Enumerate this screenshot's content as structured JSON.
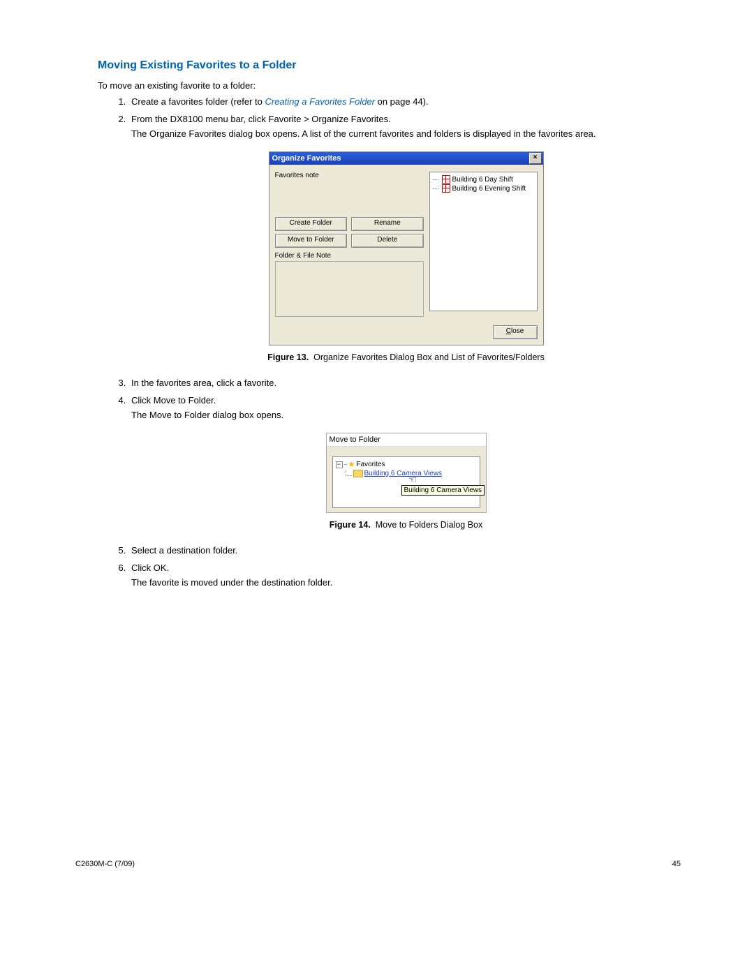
{
  "heading": "Moving Existing Favorites to a Folder",
  "intro": "To move an existing favorite to a folder:",
  "steps": {
    "s1_prefix": "Create a favorites folder (refer to ",
    "s1_link": "Creating a Favorites Folder",
    "s1_suffix": " on page 44).",
    "s2_a": "From the DX8100 menu bar, click Favorite > Organize Favorites.",
    "s2_b": "The Organize Favorites dialog box opens. A list of the current favorites and folders is displayed in the favorites area.",
    "s3": "In the favorites area, click a favorite.",
    "s4_a": "Click Move to Folder.",
    "s4_b": "The Move to Folder dialog box opens.",
    "s5": "Select a destination folder.",
    "s6_a": "Click OK.",
    "s6_b": "The favorite is moved under the destination folder."
  },
  "fig13": {
    "caption_label": "Figure 13.",
    "caption_text": "Organize Favorites Dialog Box and List of Favorites/Folders",
    "title": "Organize Favorites",
    "favorites_note_label": "Favorites note",
    "btn_create": "Create Folder",
    "btn_rename": "Rename",
    "btn_move": "Move to Folder",
    "btn_delete": "Delete",
    "file_note_label": "Folder & File Note",
    "tree_item_1": "Building 6 Day Shift",
    "tree_item_2": "Building 6 Evening Shift",
    "btn_close_letter": "C",
    "btn_close_rest": "lose"
  },
  "fig14": {
    "caption_label": "Figure 14.",
    "caption_text": "Move to Folders Dialog Box",
    "title": "Move to Folder",
    "root": "Favorites",
    "folder": "Building 6 Camera Views",
    "tooltip": "Building 6 Camera Views"
  },
  "footer": {
    "left": "C2630M-C (7/09)",
    "right": "45"
  }
}
